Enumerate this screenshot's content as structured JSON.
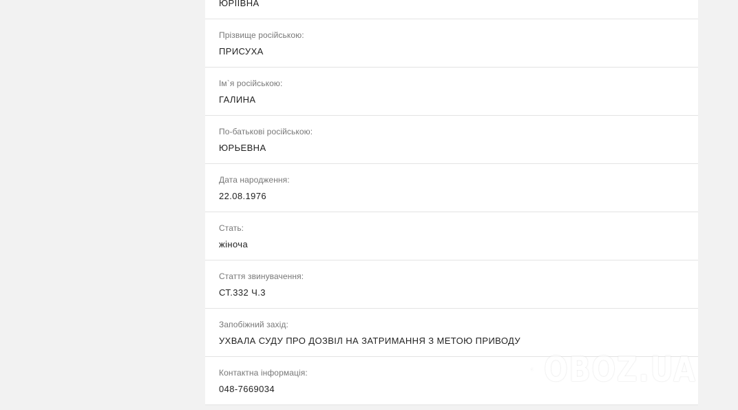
{
  "fields": [
    {
      "label": "",
      "value": "ЮРІЇВНА"
    },
    {
      "label": "Прізвище російською:",
      "value": "ПРИСУХА"
    },
    {
      "label": "Ім`я російською:",
      "value": "ГАЛИНА"
    },
    {
      "label": "По-батькові російською:",
      "value": "ЮРЬЕВНА"
    },
    {
      "label": "Дата народження:",
      "value": "22.08.1976"
    },
    {
      "label": "Стать:",
      "value": "жіноча"
    },
    {
      "label": "Стаття звинувачення:",
      "value": "СТ.332 Ч.3"
    },
    {
      "label": "Запобіжний захід:",
      "value": "УХВАЛА СУДУ ПРО ДОЗВІЛ НА ЗАТРИМАННЯ З МЕТОЮ ПРИВОДУ"
    },
    {
      "label": "Контактна інформація:",
      "value": "048-7669034"
    }
  ],
  "watermark": {
    "text": "OBOZ.UA",
    "icon": "globe-logo-icon"
  },
  "colors": {
    "page_bg": "#f2f2f2",
    "card_bg": "#ffffff",
    "divider": "#e3e3e3",
    "label": "#777777",
    "value": "#1f1f1f"
  }
}
